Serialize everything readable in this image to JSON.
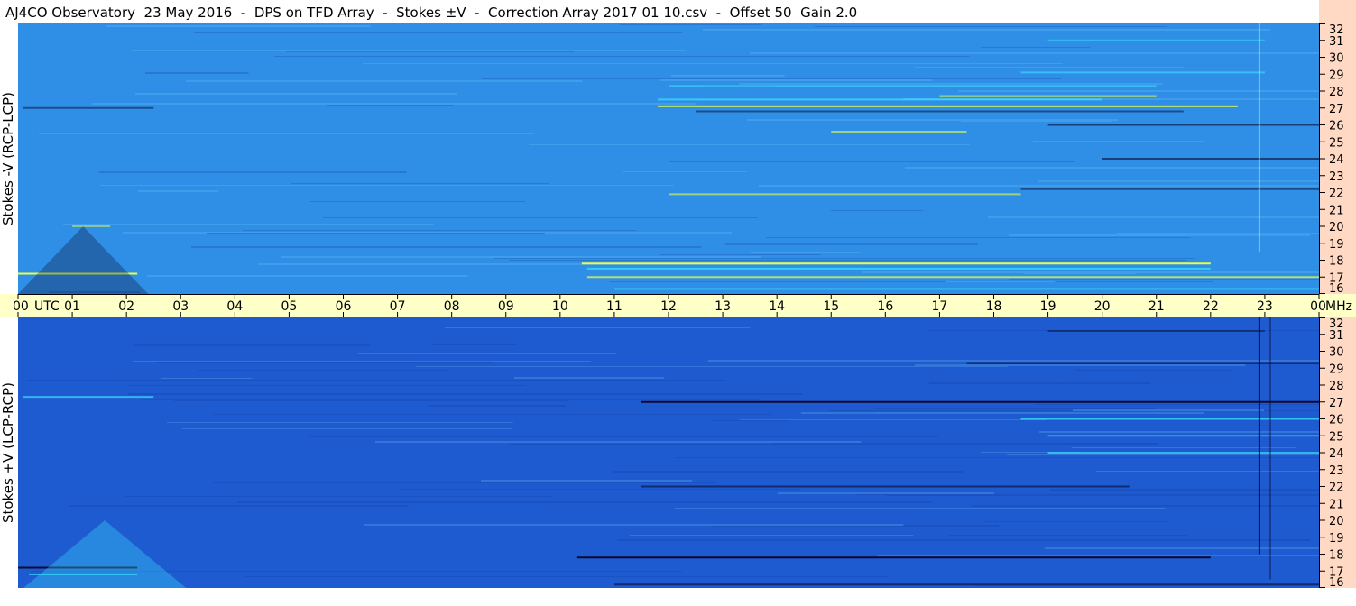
{
  "title": "AJ4CO Observatory  23 May 2016  -  DPS on TFD Array  -  Stokes ±V  -  Correction Array 2017 01 10.csv  -  Offset 50  Gain 2.0",
  "colors": {
    "background_light": "#2f8fe6",
    "background_dark": "#1f5bd0",
    "time_axis_bg": "#ffffc8",
    "freq_axis_bg": "#ffd9c4",
    "emission_yellow": "#e8ff44",
    "emission_cyan": "#3ff0ff",
    "absorption_black": "#0a0a30"
  },
  "chart_data": [
    {
      "type": "heatmap",
      "panel": "top",
      "ylabel": "Stokes -V (RCP-LCP)",
      "x_ticks": [
        "00",
        "01",
        "02",
        "03",
        "04",
        "05",
        "06",
        "07",
        "08",
        "09",
        "10",
        "11",
        "12",
        "13",
        "14",
        "15",
        "16",
        "17",
        "18",
        "19",
        "20",
        "21",
        "22",
        "23",
        "00"
      ],
      "x_unit": "UTC",
      "x_range_hours": [
        0,
        24
      ],
      "y_ticks": [
        "16",
        "17",
        "18",
        "19",
        "20",
        "21",
        "22",
        "23",
        "24",
        "25",
        "26",
        "27",
        "28",
        "29",
        "30",
        "31",
        "32"
      ],
      "y_unit": "MHz",
      "y_range_mhz": [
        16,
        32
      ],
      "features": [
        {
          "kind": "band",
          "mhz": 27.0,
          "start_h": 0.1,
          "end_h": 2.5,
          "color": "dark",
          "strength": 0.5
        },
        {
          "kind": "band",
          "mhz": 27.1,
          "start_h": 11.8,
          "end_h": 22.5,
          "color": "yellow",
          "strength": 0.8
        },
        {
          "kind": "band",
          "mhz": 27.5,
          "start_h": 11.8,
          "end_h": 20.0,
          "color": "cyan",
          "strength": 0.6
        },
        {
          "kind": "band",
          "mhz": 27.7,
          "start_h": 17.0,
          "end_h": 21.0,
          "color": "yellow",
          "strength": 0.8
        },
        {
          "kind": "band",
          "mhz": 28.3,
          "start_h": 12.0,
          "end_h": 21.0,
          "color": "cyan",
          "strength": 0.5
        },
        {
          "kind": "band",
          "mhz": 29.1,
          "start_h": 18.5,
          "end_h": 23.0,
          "color": "cyan",
          "strength": 0.5
        },
        {
          "kind": "band",
          "mhz": 31.0,
          "start_h": 19.0,
          "end_h": 23.0,
          "color": "cyan",
          "strength": 0.4
        },
        {
          "kind": "band",
          "mhz": 26.8,
          "start_h": 12.5,
          "end_h": 21.5,
          "color": "dark",
          "strength": 0.5
        },
        {
          "kind": "band",
          "mhz": 26.0,
          "start_h": 19.0,
          "end_h": 24.0,
          "color": "dark",
          "strength": 0.6
        },
        {
          "kind": "band",
          "mhz": 25.6,
          "start_h": 15.0,
          "end_h": 17.5,
          "color": "yellow",
          "strength": 0.6
        },
        {
          "kind": "band",
          "mhz": 24.0,
          "start_h": 20.0,
          "end_h": 24.0,
          "color": "dark",
          "strength": 0.6
        },
        {
          "kind": "band",
          "mhz": 21.9,
          "start_h": 12.0,
          "end_h": 18.5,
          "color": "yellow",
          "strength": 0.6
        },
        {
          "kind": "band",
          "mhz": 22.2,
          "start_h": 18.5,
          "end_h": 24.0,
          "color": "dark",
          "strength": 0.5
        },
        {
          "kind": "band",
          "mhz": 20.0,
          "start_h": 1.0,
          "end_h": 1.7,
          "color": "yellow",
          "strength": 0.5
        },
        {
          "kind": "band",
          "mhz": 17.8,
          "start_h": 10.4,
          "end_h": 22.0,
          "color": "yellow",
          "strength": 1.0
        },
        {
          "kind": "band",
          "mhz": 17.5,
          "start_h": 10.5,
          "end_h": 22.0,
          "color": "cyan",
          "strength": 0.6
        },
        {
          "kind": "band",
          "mhz": 17.2,
          "start_h": 0.0,
          "end_h": 2.2,
          "color": "yellow",
          "strength": 1.0
        },
        {
          "kind": "band",
          "mhz": 17.0,
          "start_h": 10.5,
          "end_h": 24.0,
          "color": "yellow",
          "strength": 0.7
        },
        {
          "kind": "band",
          "mhz": 16.3,
          "start_h": 11.0,
          "end_h": 24.0,
          "color": "cyan",
          "strength": 0.5
        },
        {
          "kind": "vline",
          "hour": 22.9,
          "start_mhz": 18.5,
          "end_mhz": 32.0,
          "color": "yellow",
          "strength": 0.5
        },
        {
          "kind": "triangle",
          "center_h": 1.2,
          "half_width_h": 1.2,
          "top_mhz": 20.0,
          "color": "dark",
          "strength": 0.5
        }
      ]
    },
    {
      "type": "heatmap",
      "panel": "bottom",
      "ylabel": "Stokes +V (LCP-RCP)",
      "x_ticks": [
        "00",
        "01",
        "02",
        "03",
        "04",
        "05",
        "06",
        "07",
        "08",
        "09",
        "10",
        "11",
        "12",
        "13",
        "14",
        "15",
        "16",
        "17",
        "18",
        "19",
        "20",
        "21",
        "22",
        "23",
        "00"
      ],
      "x_unit": "UTC",
      "x_range_hours": [
        0,
        24
      ],
      "y_ticks": [
        "16",
        "17",
        "18",
        "19",
        "20",
        "21",
        "22",
        "23",
        "24",
        "25",
        "26",
        "27",
        "28",
        "29",
        "30",
        "31",
        "32"
      ],
      "y_unit": "MHz",
      "y_range_mhz": [
        16,
        32
      ],
      "features": [
        {
          "kind": "band",
          "mhz": 27.0,
          "start_h": 11.5,
          "end_h": 24.0,
          "color": "dark",
          "strength": 1.0
        },
        {
          "kind": "band",
          "mhz": 27.3,
          "start_h": 0.1,
          "end_h": 2.5,
          "color": "cyan",
          "strength": 0.6
        },
        {
          "kind": "band",
          "mhz": 29.3,
          "start_h": 17.5,
          "end_h": 24.0,
          "color": "dark",
          "strength": 0.9
        },
        {
          "kind": "band",
          "mhz": 31.2,
          "start_h": 19.0,
          "end_h": 23.0,
          "color": "dark",
          "strength": 0.5
        },
        {
          "kind": "band",
          "mhz": 26.0,
          "start_h": 18.5,
          "end_h": 24.0,
          "color": "cyan",
          "strength": 0.7
        },
        {
          "kind": "band",
          "mhz": 25.0,
          "start_h": 19.0,
          "end_h": 24.0,
          "color": "cyan",
          "strength": 0.5
        },
        {
          "kind": "band",
          "mhz": 24.0,
          "start_h": 19.0,
          "end_h": 24.0,
          "color": "cyan",
          "strength": 0.6
        },
        {
          "kind": "band",
          "mhz": 22.0,
          "start_h": 11.5,
          "end_h": 20.5,
          "color": "dark",
          "strength": 0.6
        },
        {
          "kind": "band",
          "mhz": 17.8,
          "start_h": 10.3,
          "end_h": 22.0,
          "color": "dark",
          "strength": 1.0
        },
        {
          "kind": "band",
          "mhz": 17.2,
          "start_h": 0.0,
          "end_h": 2.2,
          "color": "dark",
          "strength": 1.0
        },
        {
          "kind": "band",
          "mhz": 16.2,
          "start_h": 11.0,
          "end_h": 24.0,
          "color": "dark",
          "strength": 0.6
        },
        {
          "kind": "band",
          "mhz": 16.8,
          "start_h": 0.2,
          "end_h": 2.2,
          "color": "cyan",
          "strength": 0.6
        },
        {
          "kind": "vline",
          "hour": 22.9,
          "start_mhz": 18.0,
          "end_mhz": 32.0,
          "color": "dark",
          "strength": 0.9
        },
        {
          "kind": "vline",
          "hour": 23.1,
          "start_mhz": 16.5,
          "end_mhz": 32.0,
          "color": "dark",
          "strength": 0.4
        },
        {
          "kind": "triangle",
          "center_h": 1.6,
          "half_width_h": 1.5,
          "top_mhz": 20.0,
          "color": "cyan",
          "strength": 0.5
        }
      ]
    }
  ]
}
